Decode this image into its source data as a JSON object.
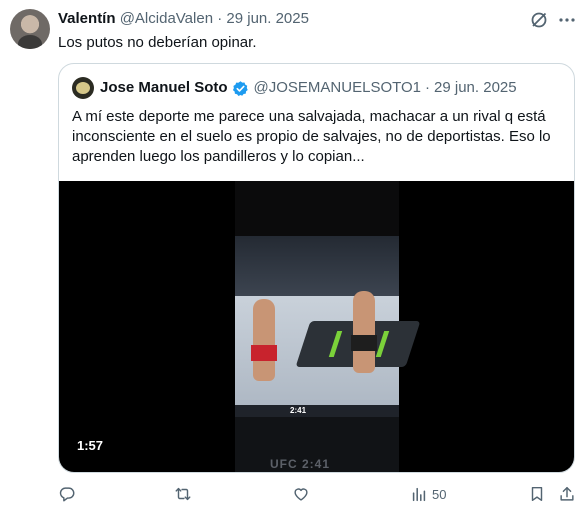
{
  "tweet": {
    "author": {
      "name": "Valentín",
      "handle": "@AlcidaValen",
      "date": "29 jun. 2025"
    },
    "text": "Los putos no deberían opinar."
  },
  "quote": {
    "author": {
      "name": "Jose Manuel Soto",
      "handle": "@JOSEMANUELSOTO1",
      "date": "29 jun. 2025",
      "verified": true
    },
    "text": "A mí este deporte me parece una salvajada, machacar a un rival q está inconsciente en el suelo es propio de salvajes, no de deportistas. Eso lo aprenden luego los pandilleros y lo copian...",
    "video": {
      "duration": "1:57",
      "scoreboard_time": "2:41",
      "bottom_overlay": "UFC 2:41"
    }
  },
  "actions": {
    "reply_icon": "reply-icon",
    "retweet_icon": "retweet-icon",
    "like_icon": "heart-icon",
    "views_icon": "views-icon",
    "views_count": "50",
    "bookmark_icon": "bookmark-icon",
    "share_icon": "share-icon"
  },
  "colors": {
    "text": "#0f1419",
    "muted": "#536471",
    "border": "#cfd9de",
    "verified": "#1d9bf0"
  }
}
